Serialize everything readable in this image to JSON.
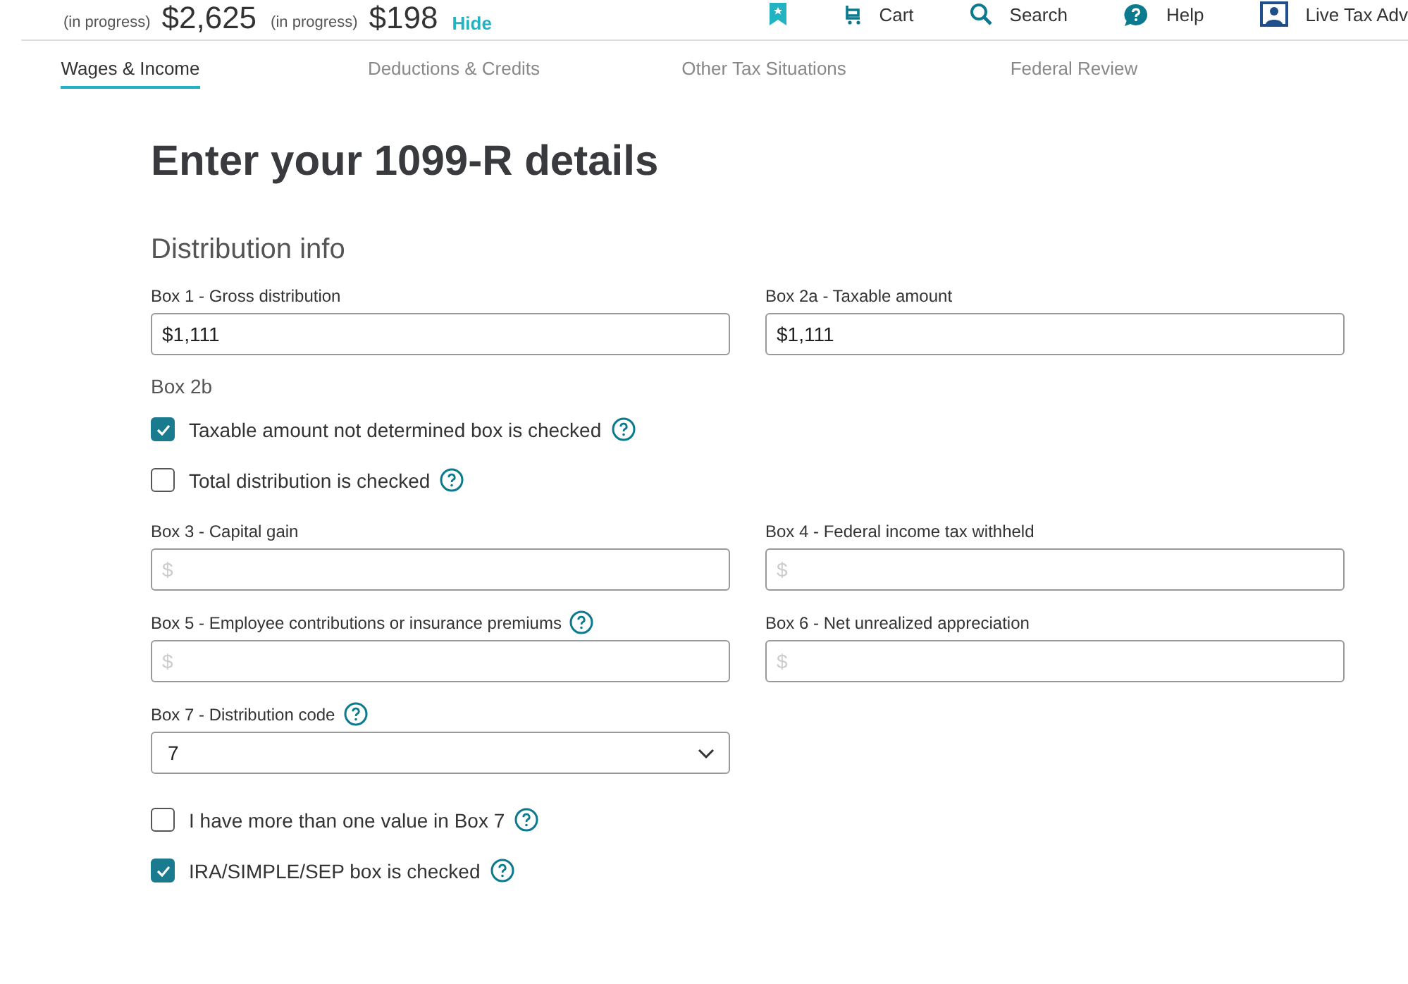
{
  "header": {
    "dues": [
      {
        "sublabel": "(in progress)",
        "amount": "$2,625"
      },
      {
        "sublabel": "(in progress)",
        "amount": "$198"
      }
    ],
    "hide_link": "Hide",
    "nav": [
      {
        "kind": "bookmark"
      },
      {
        "kind": "cart",
        "label": "Cart"
      },
      {
        "kind": "search",
        "label": "Search"
      },
      {
        "kind": "help",
        "label": "Help"
      },
      {
        "kind": "person",
        "label": "Live Tax Adv"
      }
    ]
  },
  "tabs": [
    {
      "label": "Wages & Income",
      "selected": true
    },
    {
      "label": "Deductions & Credits",
      "selected": false
    },
    {
      "label": "Other Tax Situations",
      "selected": false
    },
    {
      "label": "Federal Review",
      "selected": false
    }
  ],
  "title": "Enter your 1099-R details",
  "section": "Distribution info",
  "form": [
    {
      "kind": "fields",
      "items": [
        {
          "label": "Box 1 - Gross distribution",
          "value": "$1,111"
        },
        {
          "label": "Box 2a - Taxable amount",
          "value": "$1,111"
        }
      ]
    },
    {
      "kind": "label",
      "text": "Box 2b"
    },
    {
      "kind": "checkbox",
      "label": "Taxable amount not determined box is checked",
      "checked": true,
      "help": true
    },
    {
      "kind": "checkbox",
      "label": "Total distribution is checked",
      "checked": false,
      "help": true
    },
    {
      "kind": "fields",
      "items": [
        {
          "label": "Box 3 - Capital gain",
          "placeholder": "$"
        },
        {
          "label": "Box 4 - Federal income tax withheld",
          "placeholder": "$"
        }
      ]
    },
    {
      "kind": "fields",
      "items": [
        {
          "label": "Box 5 - Employee contributions or insurance premiums",
          "placeholder": "$",
          "help": true
        },
        {
          "label": "Box 6 - Net unrealized appreciation",
          "placeholder": "$"
        }
      ]
    },
    {
      "kind": "select",
      "label": "Box 7 - Distribution code",
      "value": "7",
      "help": true
    },
    {
      "kind": "checkbox",
      "label": "I have more than one value in Box 7",
      "checked": false,
      "help": true
    },
    {
      "kind": "checkbox",
      "label": "IRA/SIMPLE/SEP box is checked",
      "checked": true,
      "help": true
    }
  ]
}
